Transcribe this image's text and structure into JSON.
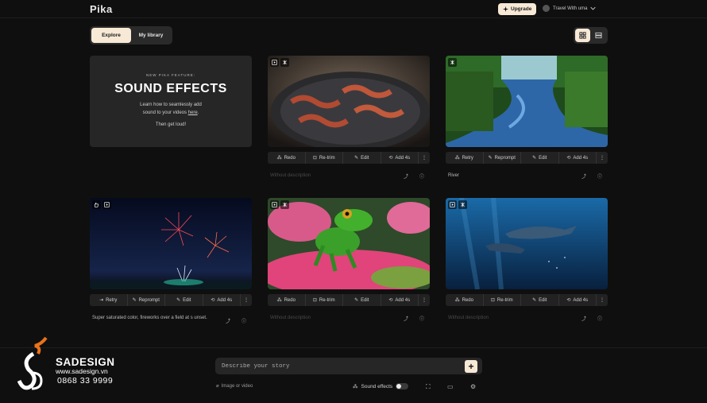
{
  "app": {
    "logo": "Pika"
  },
  "header": {
    "upgrade_label": "Upgrade",
    "user_name": "Travel With uma"
  },
  "tabs": [
    {
      "label": "Explore",
      "active": true
    },
    {
      "label": "My library",
      "active": false
    }
  ],
  "promo": {
    "kicker": "NEW PIKA FEATURE:",
    "title": "SOUND EFFECTS",
    "desc_line1": "Learn how to seamlessly add",
    "desc_line2_prefix": "sound to your videos ",
    "desc_link": "here",
    "desc_line2_suffix": ".",
    "tagline": "Then get loud!"
  },
  "cards": [
    {
      "scene": "bacon",
      "actions": [
        "Redo",
        "Re-trim",
        "Edit",
        "Add 4s"
      ],
      "description": "Without description",
      "has_description": false
    },
    {
      "scene": "river",
      "actions": [
        "Retry",
        "Reprompt",
        "Edit",
        "Add 4s"
      ],
      "description": "River",
      "has_description": true
    },
    {
      "scene": "fireworks",
      "actions": [
        "Retry",
        "Reprompt",
        "Edit",
        "Add 4s"
      ],
      "description": "Super saturated color, fireworks over a field at s unset.",
      "has_description": true
    },
    {
      "scene": "frog",
      "actions": [
        "Redo",
        "Re-trim",
        "Edit",
        "Add 4s"
      ],
      "description": "Without description",
      "has_description": false
    },
    {
      "scene": "dolphins",
      "actions": [
        "Redo",
        "Re-trim",
        "Edit",
        "Add 4s"
      ],
      "description": "Without description",
      "has_description": false
    }
  ],
  "composer": {
    "placeholder": "Describe your story",
    "image_url_label": "Image or video",
    "sound_effects_label": "Sound effects",
    "sound_effects_on": false
  },
  "watermark": {
    "brand": "SADESIGN",
    "url": "www.sadesign.vn",
    "phone": "0868 33 9999"
  },
  "colors": {
    "accent": "#f7e9d6",
    "background": "#0f0f0f",
    "card": "#222222"
  }
}
